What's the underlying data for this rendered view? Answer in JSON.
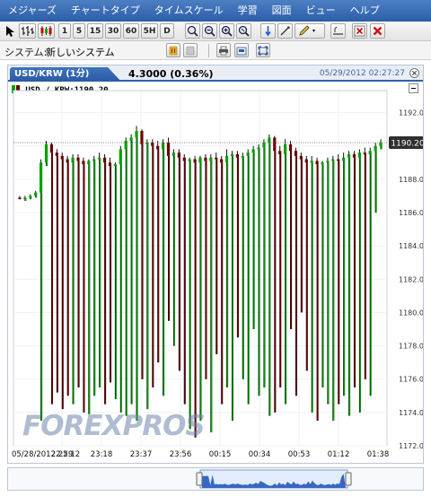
{
  "menu": {
    "items": [
      "メジャーズ",
      "チャートタイプ",
      "タイムスケール",
      "学習",
      "図面",
      "ビュー",
      "ヘルプ"
    ]
  },
  "toolbar": {
    "timeframes": [
      "1",
      "5",
      "15",
      "30",
      "60",
      "5H",
      "D"
    ]
  },
  "system": {
    "label": "システム:",
    "value": "新しいシステム"
  },
  "panel": {
    "tab_label": "USD/KRW (1分)",
    "price_change": "4.3000 (0.36%)",
    "datetime": "05/29/2012 02:27:27",
    "legend": "USD / KRW:1190.20",
    "watermark": "FOREXPROS"
  },
  "colors": {
    "menubar": "#2b5ea8",
    "up_candle": "#00a000",
    "down_candle": "#6b0000",
    "price_tag": "#2f2f2f"
  },
  "chart_data": {
    "type": "candlestick",
    "symbol": "USD / KRW",
    "interval": "1分",
    "current_price": "1190.20",
    "ylim": [
      1172,
      1193
    ],
    "y_ticks": [
      "1192.00",
      "1190.00",
      "1188.00",
      "1186.00",
      "1184.00",
      "1182.00",
      "1180.00",
      "1178.00",
      "1176.00",
      "1174.00",
      "1172.00"
    ],
    "y_tick_values": [
      1192,
      1190,
      1188,
      1186,
      1184,
      1182,
      1180,
      1178,
      1176,
      1174,
      1172
    ],
    "x_ticks": [
      "05/28/2012 22:12",
      "22:59",
      "23:18",
      "23:37",
      "23:56",
      "00:15",
      "00:34",
      "00:53",
      "01:12",
      "01:38"
    ],
    "grid": true,
    "candles": [
      {
        "o": 1186.9,
        "h": 1187.0,
        "l": 1186.8,
        "c": 1186.8
      },
      {
        "o": 1186.8,
        "h": 1187.0,
        "l": 1186.7,
        "c": 1186.9
      },
      {
        "o": 1186.9,
        "h": 1187.1,
        "l": 1186.8,
        "c": 1187.0
      },
      {
        "o": 1187.0,
        "h": 1187.3,
        "l": 1186.9,
        "c": 1187.2
      },
      {
        "o": 1187.2,
        "h": 1189.2,
        "l": 1173.5,
        "c": 1189.0
      },
      {
        "o": 1189.0,
        "h": 1190.3,
        "l": 1188.8,
        "c": 1190.1
      },
      {
        "o": 1190.1,
        "h": 1190.2,
        "l": 1174.5,
        "c": 1189.6
      },
      {
        "o": 1189.6,
        "h": 1189.8,
        "l": 1175.2,
        "c": 1189.4
      },
      {
        "o": 1189.4,
        "h": 1189.6,
        "l": 1174.2,
        "c": 1189.2
      },
      {
        "o": 1189.2,
        "h": 1189.4,
        "l": 1175.0,
        "c": 1189.0
      },
      {
        "o": 1189.0,
        "h": 1189.5,
        "l": 1174.5,
        "c": 1189.3
      },
      {
        "o": 1189.3,
        "h": 1189.5,
        "l": 1175.5,
        "c": 1189.1
      },
      {
        "o": 1189.1,
        "h": 1189.3,
        "l": 1174.0,
        "c": 1188.9
      },
      {
        "o": 1188.9,
        "h": 1189.2,
        "l": 1173.9,
        "c": 1189.1
      },
      {
        "o": 1189.1,
        "h": 1189.4,
        "l": 1175.0,
        "c": 1189.2
      },
      {
        "o": 1189.2,
        "h": 1189.6,
        "l": 1175.5,
        "c": 1189.3
      },
      {
        "o": 1189.3,
        "h": 1189.5,
        "l": 1174.5,
        "c": 1189.0
      },
      {
        "o": 1189.0,
        "h": 1189.3,
        "l": 1175.8,
        "c": 1188.8
      },
      {
        "o": 1188.8,
        "h": 1189.0,
        "l": 1174.8,
        "c": 1188.9
      },
      {
        "o": 1188.9,
        "h": 1190.0,
        "l": 1174.0,
        "c": 1189.8
      },
      {
        "o": 1189.8,
        "h": 1190.5,
        "l": 1173.8,
        "c": 1190.3
      },
      {
        "o": 1190.3,
        "h": 1190.7,
        "l": 1174.5,
        "c": 1190.5
      },
      {
        "o": 1190.5,
        "h": 1191.2,
        "l": 1173.5,
        "c": 1190.9
      },
      {
        "o": 1190.9,
        "h": 1191.0,
        "l": 1176.0,
        "c": 1190.1
      },
      {
        "o": 1190.1,
        "h": 1190.4,
        "l": 1174.2,
        "c": 1190.2
      },
      {
        "o": 1190.2,
        "h": 1190.4,
        "l": 1175.5,
        "c": 1190.0
      },
      {
        "o": 1190.0,
        "h": 1190.3,
        "l": 1177.0,
        "c": 1189.8
      },
      {
        "o": 1189.8,
        "h": 1190.4,
        "l": 1175.0,
        "c": 1190.2
      },
      {
        "o": 1190.2,
        "h": 1190.5,
        "l": 1179.5,
        "c": 1189.4
      },
      {
        "o": 1189.4,
        "h": 1189.8,
        "l": 1178.0,
        "c": 1189.6
      },
      {
        "o": 1189.6,
        "h": 1189.8,
        "l": 1176.5,
        "c": 1189.3
      },
      {
        "o": 1189.3,
        "h": 1189.5,
        "l": 1174.5,
        "c": 1189.1
      },
      {
        "o": 1189.1,
        "h": 1189.3,
        "l": 1173.0,
        "c": 1189.2
      },
      {
        "o": 1189.2,
        "h": 1189.4,
        "l": 1172.5,
        "c": 1189.0
      },
      {
        "o": 1189.0,
        "h": 1189.4,
        "l": 1173.5,
        "c": 1189.3
      },
      {
        "o": 1189.3,
        "h": 1189.5,
        "l": 1176.0,
        "c": 1189.1
      },
      {
        "o": 1189.1,
        "h": 1189.5,
        "l": 1172.8,
        "c": 1189.3
      },
      {
        "o": 1189.3,
        "h": 1189.6,
        "l": 1177.5,
        "c": 1189.2
      },
      {
        "o": 1189.2,
        "h": 1189.4,
        "l": 1174.5,
        "c": 1189.0
      },
      {
        "o": 1189.0,
        "h": 1189.8,
        "l": 1175.5,
        "c": 1189.4
      },
      {
        "o": 1189.4,
        "h": 1189.7,
        "l": 1173.5,
        "c": 1189.5
      },
      {
        "o": 1189.5,
        "h": 1189.7,
        "l": 1178.5,
        "c": 1189.3
      },
      {
        "o": 1189.3,
        "h": 1189.6,
        "l": 1176.0,
        "c": 1189.4
      },
      {
        "o": 1189.4,
        "h": 1189.8,
        "l": 1174.5,
        "c": 1189.6
      },
      {
        "o": 1189.6,
        "h": 1190.0,
        "l": 1179.0,
        "c": 1189.8
      },
      {
        "o": 1189.8,
        "h": 1190.1,
        "l": 1175.0,
        "c": 1189.9
      },
      {
        "o": 1189.9,
        "h": 1190.4,
        "l": 1175.5,
        "c": 1190.2
      },
      {
        "o": 1190.2,
        "h": 1190.7,
        "l": 1173.8,
        "c": 1190.5
      },
      {
        "o": 1190.5,
        "h": 1190.6,
        "l": 1174.0,
        "c": 1189.7
      },
      {
        "o": 1189.7,
        "h": 1190.0,
        "l": 1175.5,
        "c": 1189.5
      },
      {
        "o": 1189.5,
        "h": 1190.4,
        "l": 1174.5,
        "c": 1190.1
      },
      {
        "o": 1190.1,
        "h": 1190.3,
        "l": 1179.0,
        "c": 1189.7
      },
      {
        "o": 1189.7,
        "h": 1189.9,
        "l": 1175.0,
        "c": 1189.4
      },
      {
        "o": 1189.4,
        "h": 1189.6,
        "l": 1180.0,
        "c": 1189.2
      },
      {
        "o": 1189.2,
        "h": 1189.4,
        "l": 1176.5,
        "c": 1189.0
      },
      {
        "o": 1189.0,
        "h": 1189.4,
        "l": 1174.0,
        "c": 1189.1
      },
      {
        "o": 1189.1,
        "h": 1189.3,
        "l": 1173.5,
        "c": 1188.9
      },
      {
        "o": 1188.9,
        "h": 1189.1,
        "l": 1175.5,
        "c": 1189.0
      },
      {
        "o": 1189.0,
        "h": 1189.3,
        "l": 1174.5,
        "c": 1189.1
      },
      {
        "o": 1189.1,
        "h": 1189.4,
        "l": 1173.5,
        "c": 1189.2
      },
      {
        "o": 1189.2,
        "h": 1189.5,
        "l": 1174.5,
        "c": 1189.1
      },
      {
        "o": 1189.1,
        "h": 1189.6,
        "l": 1175.0,
        "c": 1189.3
      },
      {
        "o": 1189.3,
        "h": 1189.7,
        "l": 1173.8,
        "c": 1189.5
      },
      {
        "o": 1189.5,
        "h": 1189.7,
        "l": 1175.5,
        "c": 1189.3
      },
      {
        "o": 1189.3,
        "h": 1189.8,
        "l": 1174.0,
        "c": 1189.6
      },
      {
        "o": 1189.6,
        "h": 1189.9,
        "l": 1176.0,
        "c": 1189.5
      },
      {
        "o": 1189.5,
        "h": 1189.9,
        "l": 1175.0,
        "c": 1189.7
      },
      {
        "o": 1189.7,
        "h": 1190.2,
        "l": 1186.0,
        "c": 1190.0
      },
      {
        "o": 1190.0,
        "h": 1190.4,
        "l": 1189.8,
        "c": 1190.2
      }
    ]
  }
}
